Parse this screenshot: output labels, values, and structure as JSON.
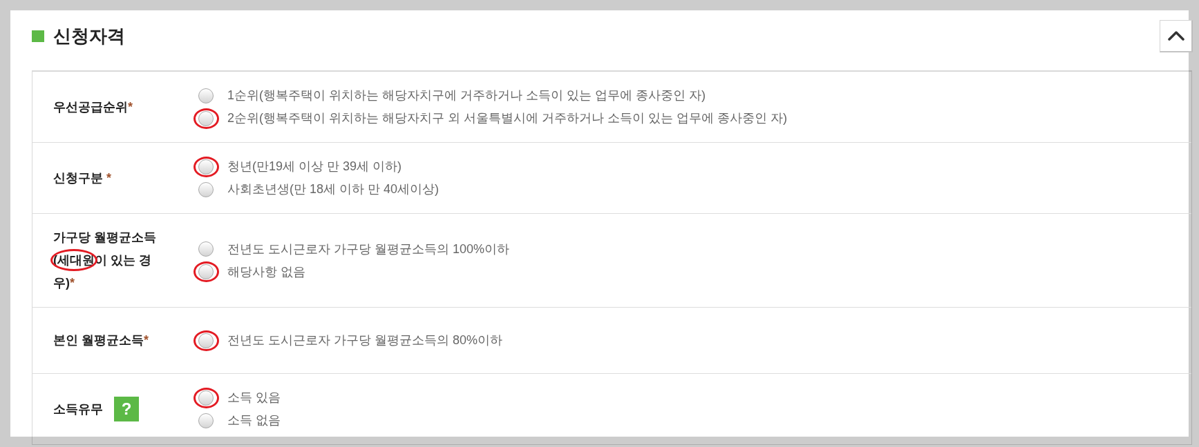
{
  "section": {
    "title": "신청자격"
  },
  "rows": [
    {
      "label_parts": [
        {
          "text": "우선공급순위",
          "circled": false
        }
      ],
      "asterisk": "*",
      "options": [
        {
          "text": "1순위(행복주택이 위치하는 해당자치구에 거주하거나 소득이 있는 업무에 종사중인 자)",
          "selected": false,
          "circled": false
        },
        {
          "text": "2순위(행복주택이 위치하는 해당자치구 외 서울특별시에 거주하거나 소득이 있는 업무에 종사중인 자)",
          "selected": false,
          "circled": true
        }
      ]
    },
    {
      "label_parts": [
        {
          "text": "신청구분 ",
          "circled": false
        }
      ],
      "asterisk": "*",
      "options": [
        {
          "text": "청년(만19세 이상 만 39세 이하)",
          "selected": false,
          "circled": true
        },
        {
          "text": "사회초년생(만 18세 이하 만 40세이상)",
          "selected": false,
          "circled": false
        }
      ]
    },
    {
      "label_parts": [
        {
          "text": "가구당 월평균소득 ",
          "circled": false
        },
        {
          "text": "(세대원",
          "circled": true
        },
        {
          "text": "이 있는 경우)",
          "circled": false
        }
      ],
      "asterisk": "*",
      "options": [
        {
          "text": "전년도 도시근로자 가구당 월평균소득의 100%이하",
          "selected": false,
          "circled": false
        },
        {
          "text": "해당사항 없음",
          "selected": false,
          "circled": true
        }
      ]
    },
    {
      "label_parts": [
        {
          "text": "본인 월평균소득",
          "circled": false
        }
      ],
      "asterisk": "*",
      "options": [
        {
          "text": "전년도 도시근로자 가구당 월평균소득의 80%이하",
          "selected": false,
          "circled": true
        }
      ]
    },
    {
      "label_parts": [
        {
          "text": "소득유무",
          "circled": false
        }
      ],
      "help": "?",
      "options": [
        {
          "text": "소득 있음",
          "selected": false,
          "circled": true
        },
        {
          "text": "소득 없음",
          "selected": false,
          "circled": false
        }
      ]
    }
  ]
}
